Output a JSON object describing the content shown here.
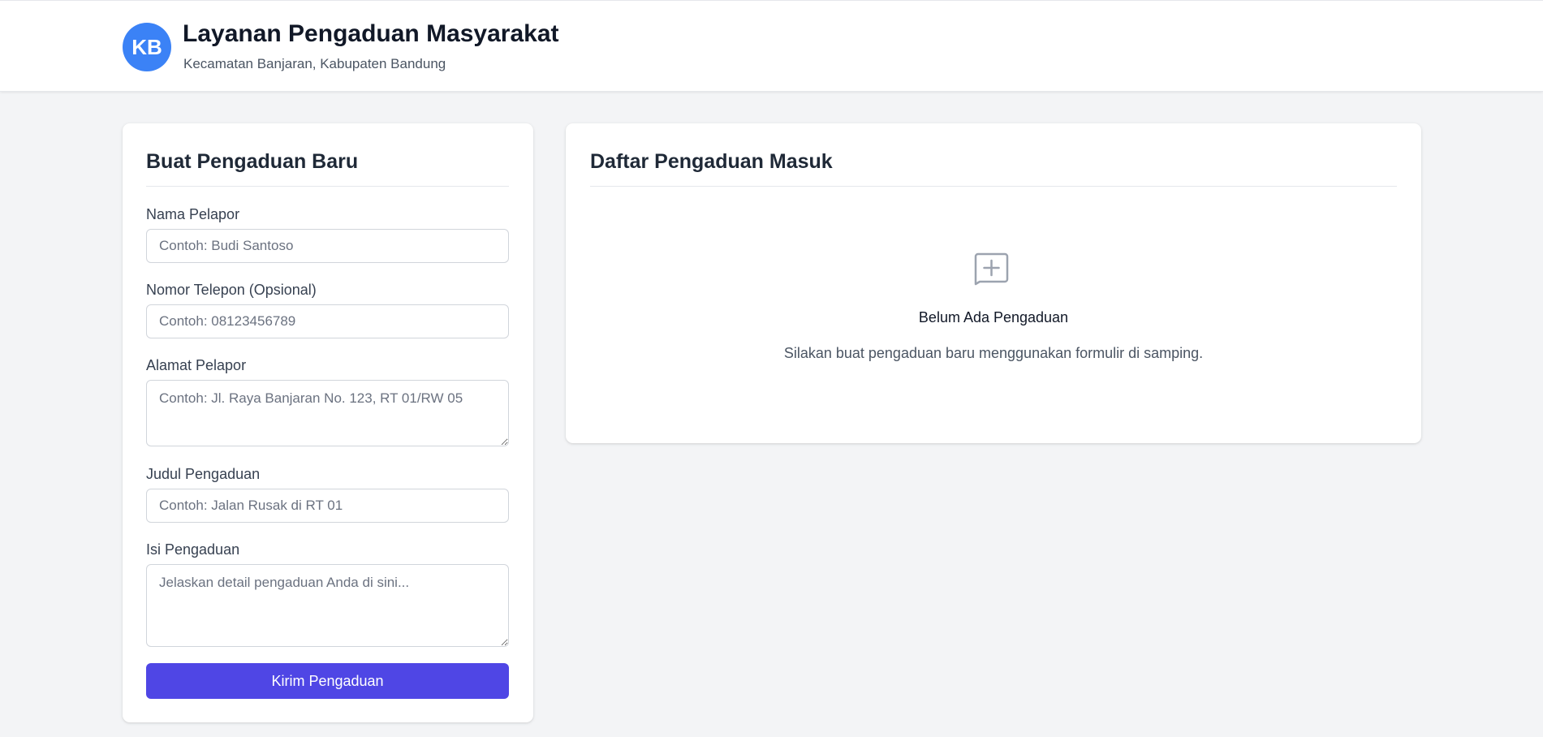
{
  "header": {
    "logo_initials": "KB",
    "title": "Layanan Pengaduan Masyarakat",
    "subtitle": "Kecamatan Banjaran, Kabupaten Bandung"
  },
  "form": {
    "title": "Buat Pengaduan Baru",
    "fields": [
      {
        "label": "Nama Pelapor",
        "placeholder": "Contoh: Budi Santoso",
        "value": ""
      },
      {
        "label": "Nomor Telepon (Opsional)",
        "placeholder": "Contoh: 08123456789",
        "value": ""
      },
      {
        "label": "Alamat Pelapor",
        "placeholder": "Contoh: Jl. Raya Banjaran No. 123, RT 01/RW 05",
        "value": ""
      },
      {
        "label": "Judul Pengaduan",
        "placeholder": "Contoh: Jalan Rusak di RT 01",
        "value": ""
      },
      {
        "label": "Isi Pengaduan",
        "placeholder": "Jelaskan detail pengaduan Anda di sini...",
        "value": ""
      }
    ],
    "submit_label": "Kirim Pengaduan"
  },
  "list": {
    "title": "Daftar Pengaduan Masuk",
    "empty_icon": "add-document-icon",
    "empty_title": "Belum Ada Pengaduan",
    "empty_text": "Silakan buat pengaduan baru menggunakan formulir di samping."
  },
  "colors": {
    "accent": "#4f46e5",
    "logo": "#3b82f6",
    "background": "#f3f4f6"
  }
}
